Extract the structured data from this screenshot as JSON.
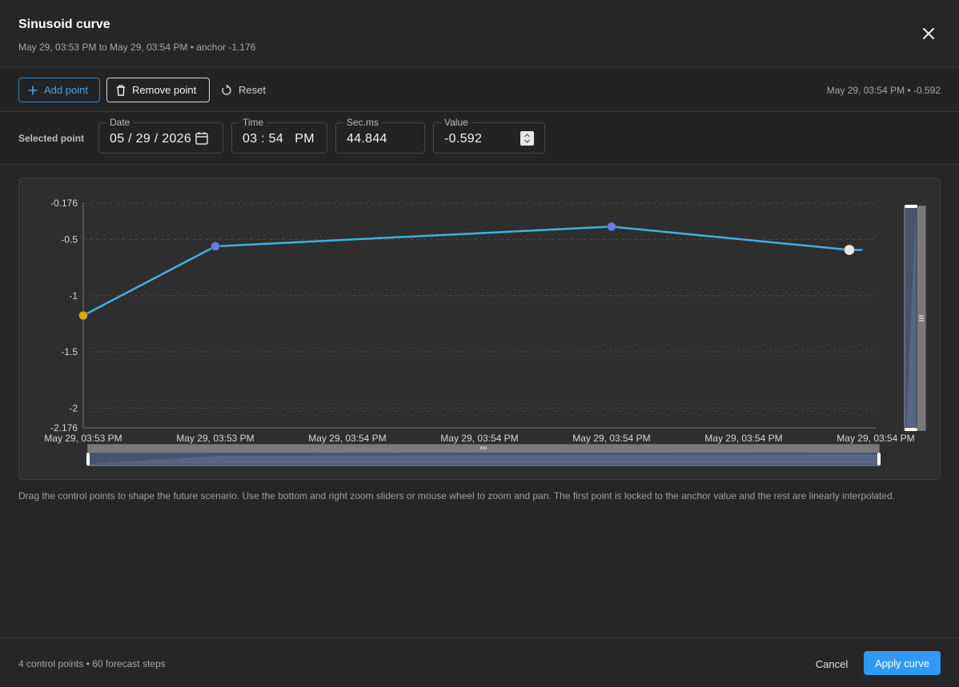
{
  "dialog": {
    "title": "Sinusoid curve",
    "subtitle": "May 29, 03:53 PM to May 29, 03:54 PM • anchor -1.176"
  },
  "toolbar": {
    "add_label": "Add point",
    "remove_label": "Remove point",
    "reset_label": "Reset",
    "status": "May 29, 03:54 PM • -0.592"
  },
  "selected_point": {
    "label": "Selected point",
    "date": {
      "label": "Date",
      "value": "05 / 29 / 2026"
    },
    "time": {
      "label": "Time",
      "value": "03 : 54   PM"
    },
    "secms": {
      "label": "Sec.ms",
      "value": "44.844"
    },
    "value": {
      "label": "Value",
      "value": "-0.592"
    }
  },
  "chart_data": {
    "type": "line",
    "x": [
      "May 29, 03:53 PM",
      "May 29, 03:53 PM",
      "May 29, 03:54 PM",
      "May 29, 03:54 PM",
      "May 29, 03:54 PM",
      "May 29, 03:54 PM",
      "May 29, 03:54 PM"
    ],
    "control_points": [
      {
        "index": 0,
        "value": -1.176,
        "role": "anchor"
      },
      {
        "index": 1,
        "value": -0.56,
        "role": "control"
      },
      {
        "index": 4,
        "value": -0.385,
        "role": "control"
      },
      {
        "index": 5.8,
        "value": -0.592,
        "role": "selected"
      }
    ],
    "line_end": {
      "index": 5.9,
      "value": -0.592
    },
    "y_ticks": [
      -0.176,
      -0.5,
      -1,
      -1.5,
      -2,
      -2.176
    ],
    "y_tick_labels": [
      "-0.176",
      "-0.5",
      "-1",
      "-1.5",
      "-2",
      "-2.176"
    ],
    "x_tick_labels": [
      "May 29, 03:53 PM",
      "May 29, 03:53 PM",
      "May 29, 03:54 PM",
      "May 29, 03:54 PM",
      "May 29, 03:54 PM",
      "May 29, 03:54 PM",
      "May 29, 03:54 PM"
    ],
    "ylim": [
      -2.176,
      -0.176
    ],
    "grid": true,
    "colors": {
      "line": "#3fb0e6",
      "anchor": "#e0a812",
      "control": "#6b7de0",
      "selected": "#e8e8e8"
    }
  },
  "hint": "Drag the control points to shape the future scenario. Use the bottom and right zoom sliders or mouse wheel to zoom and pan. The first point is locked to the anchor value and the rest are linearly interpolated.",
  "footer": {
    "status": "4 control points • 60 forecast steps",
    "cancel_label": "Cancel",
    "apply_label": "Apply curve"
  }
}
